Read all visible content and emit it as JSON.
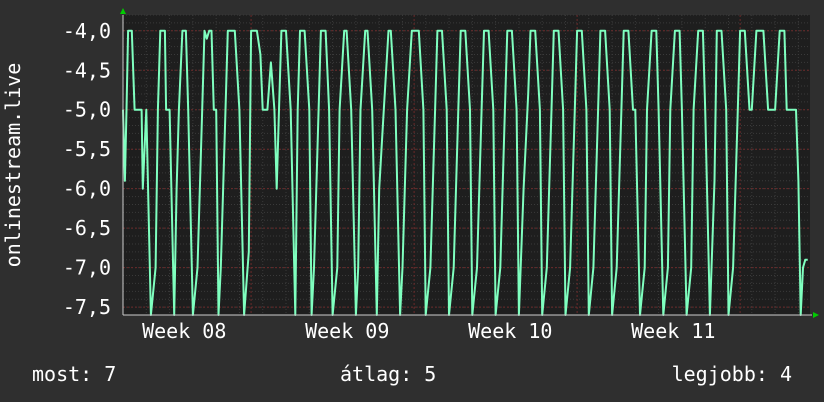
{
  "colors": {
    "background": "#2f2f2f",
    "plot_background": "#1e1e1e",
    "grid_major": "#6b2a2a",
    "grid_minor": "#3a3a3a",
    "line": "#7fffbf",
    "axis_arrow": "#00cc00",
    "text": "#ffffff"
  },
  "chart_data": {
    "type": "line",
    "ylabel": "onlinestream.live",
    "ylim": [
      -7.6,
      -3.8
    ],
    "y_ticks": [
      -4.0,
      -4.5,
      -5.0,
      -5.5,
      -6.0,
      -6.5,
      -7.0,
      -7.5
    ],
    "y_tick_labels": [
      "-4,0",
      "-4,5",
      "-5,0",
      "-5,5",
      "-6,0",
      "-6,5",
      "-7,0",
      "-7,5"
    ],
    "x_categories": [
      "Week 08",
      "Week 09",
      "Week 10",
      "Week 11"
    ],
    "xlim_days": [
      0,
      29.5
    ],
    "grid": true,
    "series": [
      {
        "values_pattern_note": "",
        "x_days": [
          0.0,
          0.08,
          0.15,
          0.22,
          0.3,
          0.38,
          0.5,
          0.8,
          0.85,
          1.0,
          1.2,
          1.4,
          1.5,
          1.6,
          1.7,
          1.8,
          1.85,
          2.0,
          2.2,
          2.3,
          2.4,
          2.55,
          2.7,
          2.8,
          3.0,
          3.2,
          3.4,
          3.5,
          3.6,
          3.7,
          3.8,
          3.9,
          4.0,
          4.1,
          4.2,
          4.4,
          4.5,
          4.6,
          4.8,
          5.0,
          5.2,
          5.4,
          5.5,
          5.6,
          5.75,
          5.9,
          6.0,
          6.1,
          6.2,
          6.35,
          6.5,
          6.6,
          6.7,
          6.8,
          6.9,
          7.0,
          7.2,
          7.4,
          7.5,
          7.6,
          7.8,
          8.0,
          8.1,
          8.2,
          8.4,
          8.5,
          8.7,
          8.85,
          9.0,
          9.2,
          9.3,
          9.5,
          9.6,
          9.8,
          10.0,
          10.1,
          10.2,
          10.4,
          10.5,
          10.7,
          10.9,
          11.0,
          11.2,
          11.4,
          11.5,
          11.7,
          11.9,
          12.0,
          12.2,
          12.4,
          12.5,
          12.7,
          12.9,
          13.0,
          13.2,
          13.4,
          13.5,
          13.7,
          13.9,
          14.0,
          14.2,
          14.4,
          14.5,
          14.7,
          14.9,
          15.0,
          15.2,
          15.4,
          15.5,
          15.7,
          15.9,
          16.0,
          16.2,
          16.4,
          16.5,
          16.7,
          16.9,
          17.0,
          17.2,
          17.4,
          17.5,
          17.7,
          17.9,
          18.0,
          18.2,
          18.4,
          18.5,
          18.7,
          18.9,
          19.0,
          19.2,
          19.4,
          19.5,
          19.7,
          19.9,
          20.0,
          20.2,
          20.4,
          20.5,
          20.7,
          20.9,
          21.0,
          21.2,
          21.4,
          21.5,
          21.7,
          21.9,
          22.0,
          22.2,
          22.4,
          22.5,
          22.7,
          22.9,
          23.0,
          23.2,
          23.4,
          23.5,
          23.7,
          23.9,
          24.0,
          24.2,
          24.4,
          24.5,
          24.7,
          24.9,
          25.0,
          25.2,
          25.4,
          25.5,
          25.7,
          25.9,
          26.0,
          26.2,
          26.4,
          26.5,
          26.7,
          26.9,
          27.0,
          27.2,
          27.4,
          27.5,
          27.7,
          27.9,
          28.0,
          28.2,
          28.4,
          28.5,
          28.7,
          28.9,
          29.0,
          29.1,
          29.2,
          29.3,
          29.4
        ],
        "values": [
          -5.0,
          -5.9,
          -5.0,
          -4.0,
          -4.0,
          -4.0,
          -5.0,
          -5.0,
          -6.0,
          -5.0,
          -7.6,
          -7.0,
          -5.0,
          -4.0,
          -4.0,
          -4.0,
          -5.0,
          -5.0,
          -7.6,
          -6.0,
          -5.0,
          -4.0,
          -4.0,
          -5.0,
          -7.6,
          -7.0,
          -5.0,
          -4.0,
          -4.1,
          -4.0,
          -4.0,
          -5.0,
          -5.0,
          -7.6,
          -7.0,
          -5.0,
          -4.0,
          -4.0,
          -4.0,
          -5.0,
          -7.6,
          -6.8,
          -4.0,
          -4.0,
          -4.0,
          -4.3,
          -5.0,
          -5.0,
          -5.0,
          -4.4,
          -5.0,
          -6.0,
          -5.0,
          -4.0,
          -4.0,
          -4.0,
          -5.0,
          -7.6,
          -5.0,
          -4.0,
          -4.0,
          -5.0,
          -7.6,
          -7.0,
          -5.0,
          -4.0,
          -4.0,
          -5.0,
          -7.6,
          -7.0,
          -5.0,
          -4.0,
          -4.0,
          -5.0,
          -7.6,
          -7.0,
          -5.0,
          -4.0,
          -4.0,
          -5.0,
          -7.6,
          -6.0,
          -5.0,
          -4.0,
          -4.0,
          -5.0,
          -7.6,
          -7.0,
          -5.0,
          -4.0,
          -4.0,
          -4.0,
          -5.0,
          -7.6,
          -7.0,
          -5.0,
          -4.0,
          -4.0,
          -5.0,
          -7.6,
          -7.0,
          -5.0,
          -4.0,
          -4.0,
          -5.0,
          -7.6,
          -7.0,
          -5.0,
          -4.0,
          -4.0,
          -5.0,
          -7.6,
          -7.0,
          -5.0,
          -4.0,
          -4.0,
          -5.0,
          -7.6,
          -6.0,
          -4.8,
          -4.0,
          -4.0,
          -5.0,
          -7.6,
          -7.0,
          -5.0,
          -4.0,
          -4.0,
          -5.0,
          -7.6,
          -7.0,
          -5.0,
          -4.0,
          -4.0,
          -5.0,
          -7.6,
          -7.0,
          -5.0,
          -4.0,
          -4.0,
          -5.0,
          -7.6,
          -7.0,
          -5.0,
          -4.0,
          -4.0,
          -5.0,
          -5.0,
          -7.6,
          -7.0,
          -5.0,
          -4.0,
          -4.0,
          -5.0,
          -7.6,
          -7.0,
          -5.0,
          -4.0,
          -4.0,
          -5.0,
          -7.6,
          -7.0,
          -5.0,
          -4.0,
          -4.0,
          -5.0,
          -7.6,
          -5.9,
          -4.0,
          -4.0,
          -5.0,
          -7.6,
          -7.0,
          -5.0,
          -4.0,
          -4.0,
          -5.0,
          -5.0,
          -4.0,
          -4.0,
          -4.0,
          -5.0,
          -5.0,
          -5.0,
          -4.0,
          -4.0,
          -5.0,
          -5.0,
          -5.0,
          -5.9,
          -7.6,
          -7.0,
          -6.9,
          -6.9
        ]
      }
    ]
  },
  "stats": {
    "now": "most: 7",
    "average": "átlag: 5",
    "best": "legjobb: 4"
  }
}
